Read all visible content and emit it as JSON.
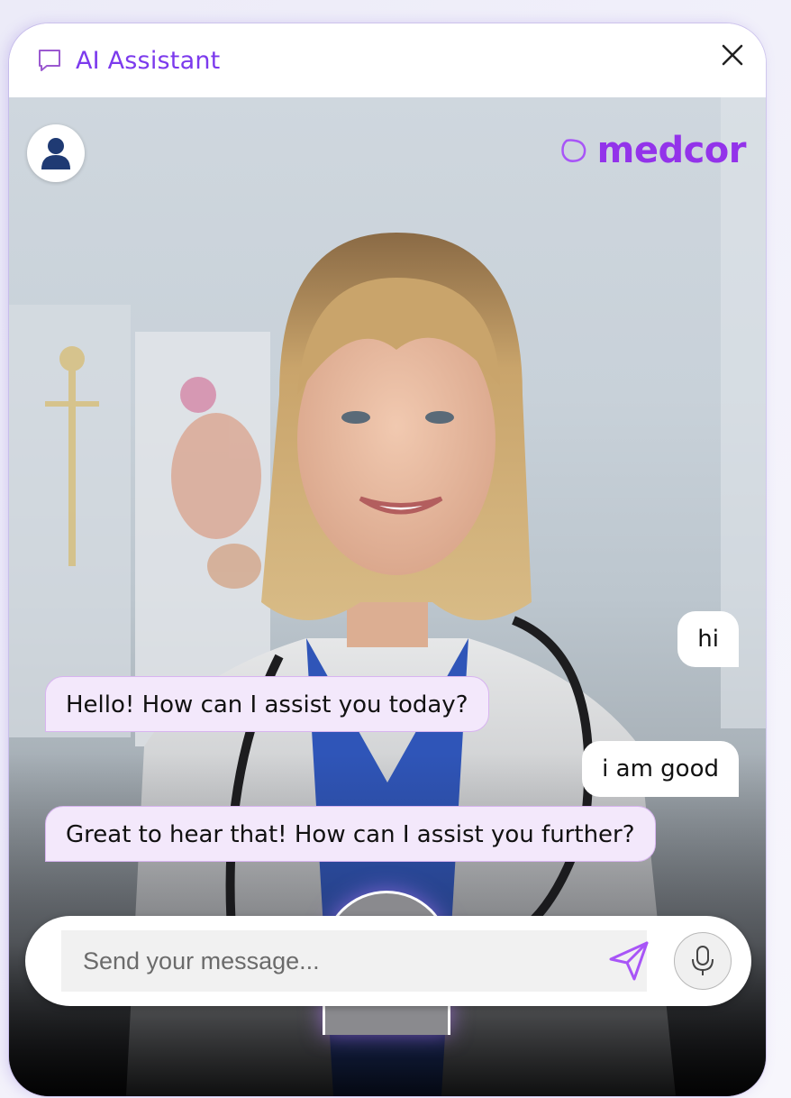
{
  "header": {
    "title": "AI Assistant",
    "icon": "chat-bubble-icon",
    "close_icon": "close-icon"
  },
  "brand": {
    "name": "medcor",
    "color": "#9333ea"
  },
  "avatar": {
    "icon": "user-icon"
  },
  "messages": [
    {
      "role": "user",
      "text": "hi"
    },
    {
      "role": "assistant",
      "text": "Hello! How can I assist you today?"
    },
    {
      "role": "user",
      "text": "i am good"
    },
    {
      "role": "assistant",
      "text": "Great to hear that! How can I assist you further?"
    }
  ],
  "composer": {
    "placeholder": "Send your message...",
    "send_icon": "send-icon",
    "mic_icon": "microphone-icon"
  },
  "colors": {
    "accent": "#7c3aed",
    "bot_bubble": "#f3e8fb",
    "user_bubble": "#ffffff"
  }
}
